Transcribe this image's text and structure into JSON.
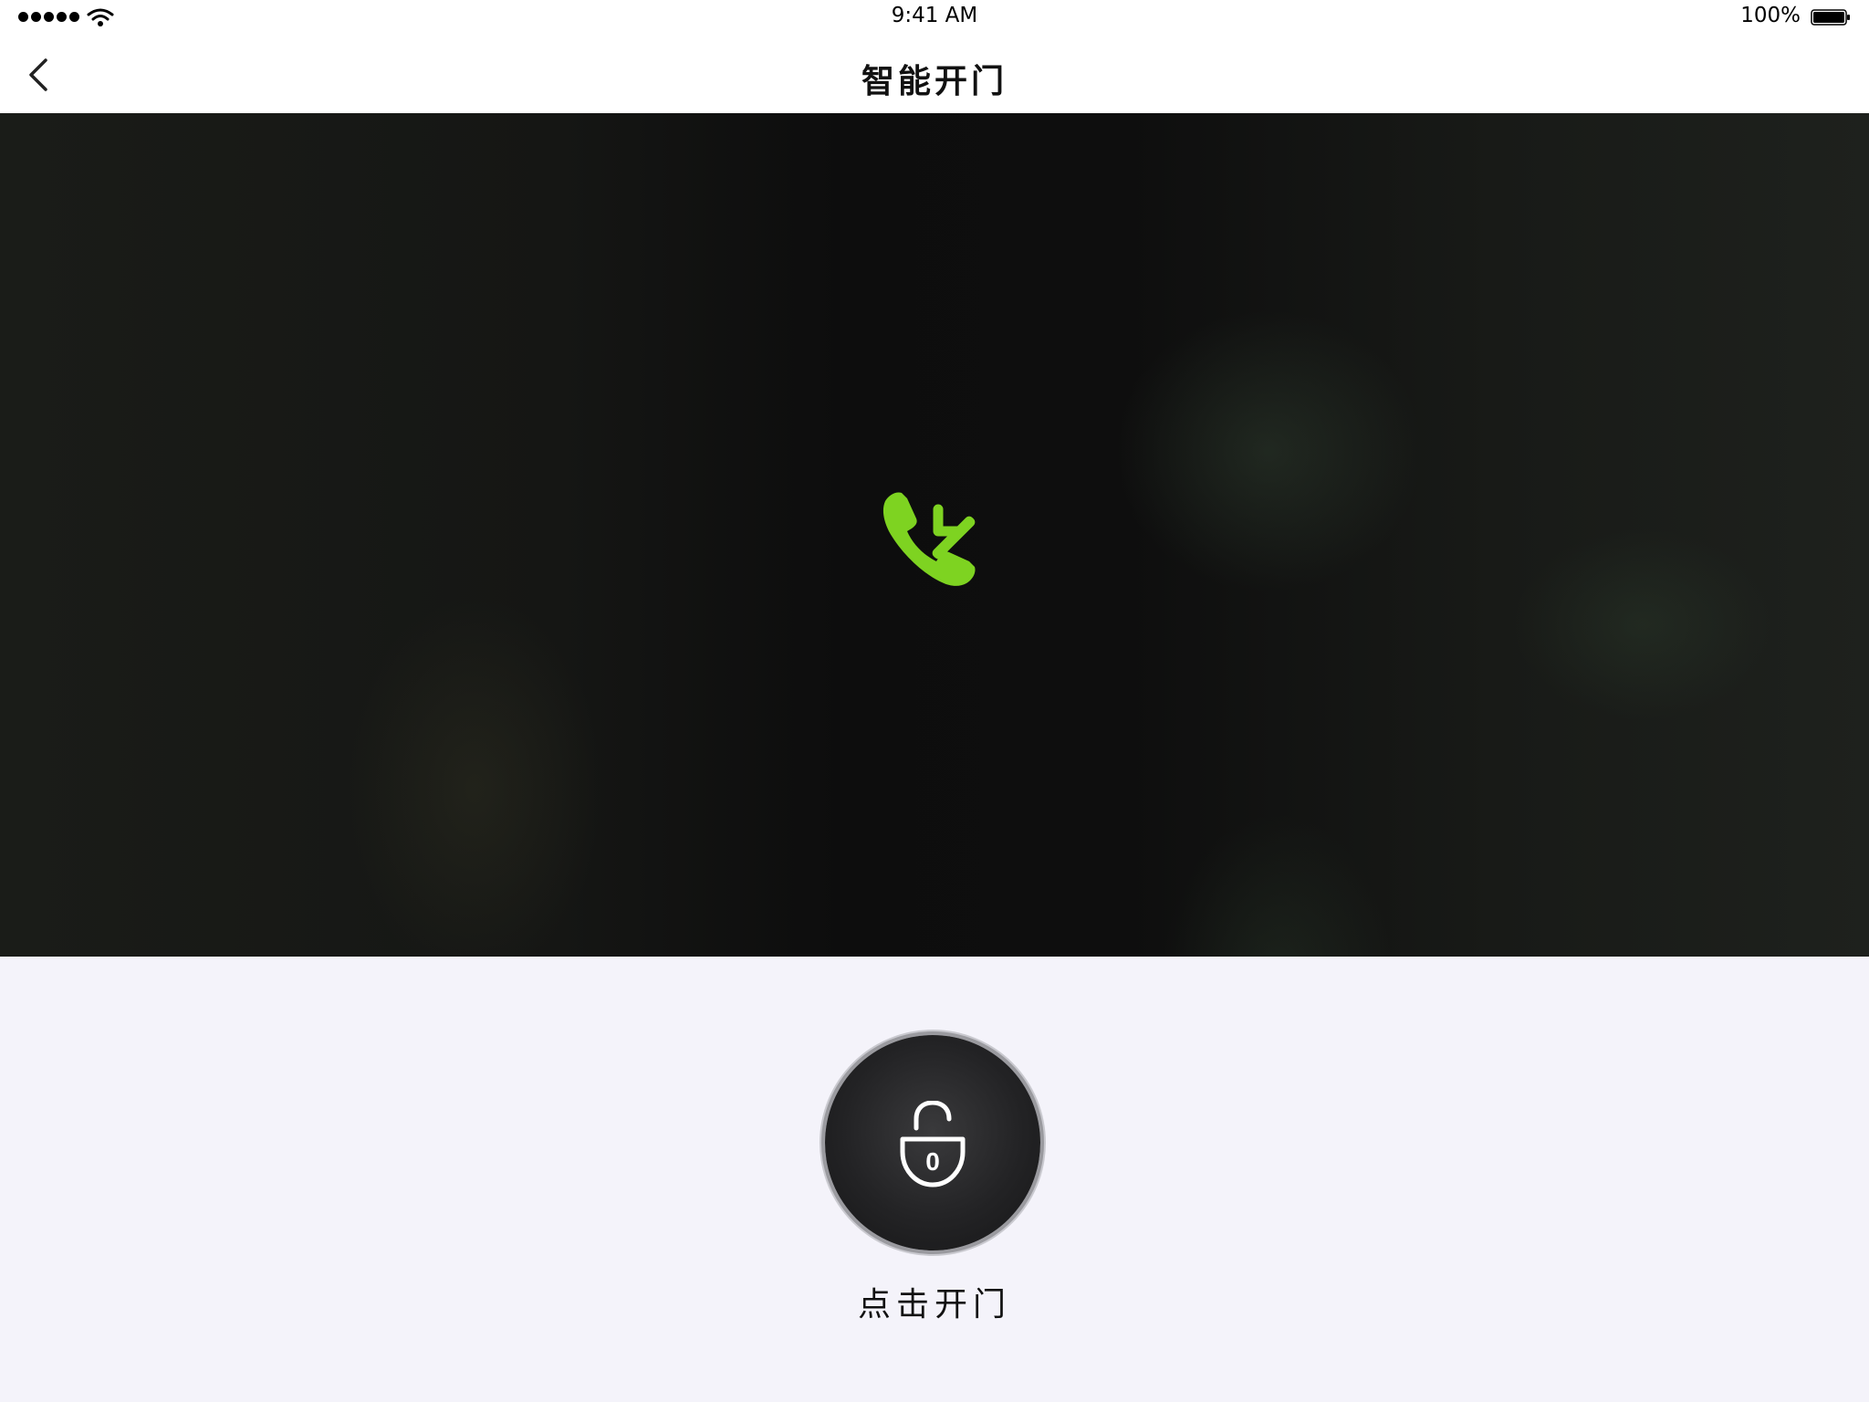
{
  "status_bar": {
    "time": "9:41 AM",
    "battery_percent": "100%",
    "signal_icon": "signal-dots-icon",
    "wifi_icon": "wifi-icon",
    "battery_icon": "battery-icon"
  },
  "nav": {
    "title": "智能开门",
    "back_icon": "chevron-left-icon"
  },
  "video": {
    "call_icon": "incoming-call-icon",
    "call_icon_color": "#7ed321"
  },
  "unlock": {
    "label": "点击开门",
    "lock_icon": "unlock-icon",
    "lock_digit": "0"
  }
}
